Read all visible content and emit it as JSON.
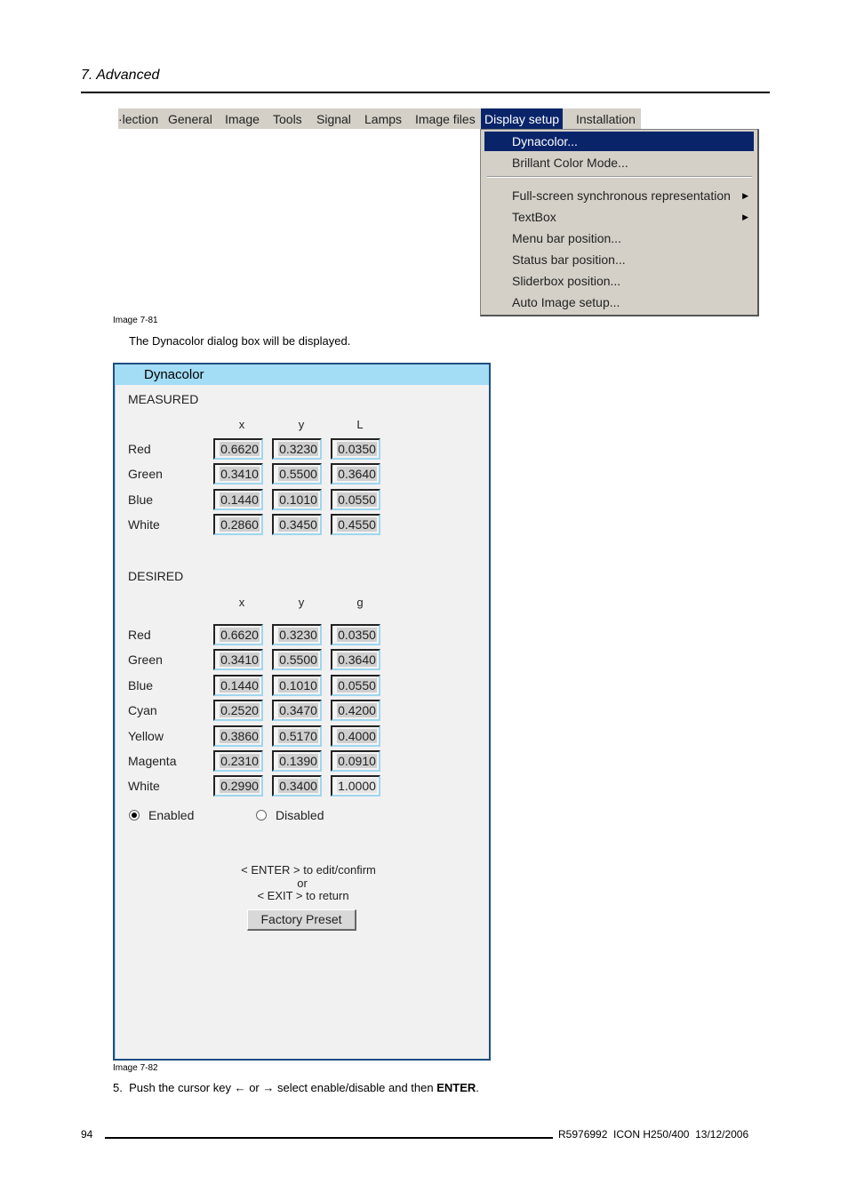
{
  "header": {
    "section": "7. Advanced"
  },
  "menubar": {
    "items": [
      "·lection",
      "General",
      "Image",
      "Tools",
      "Signal",
      "Lamps",
      "Image files",
      "Display setup",
      "Installation"
    ],
    "active": "Display setup"
  },
  "dropdown": {
    "items": [
      {
        "label": "Dynacolor..."
      },
      {
        "label": "Brillant Color Mode..."
      },
      {
        "label": "Full-screen synchronous representation",
        "arrow": "▶"
      },
      {
        "label": "TextBox",
        "arrow": "▶"
      },
      {
        "label": "Menu bar position..."
      },
      {
        "label": "Status bar position..."
      },
      {
        "label": "Sliderbox position..."
      },
      {
        "label": "Auto Image setup..."
      }
    ]
  },
  "captions": {
    "image1": "Image 7-81",
    "image2": "Image 7-82"
  },
  "intro_text": "The Dynacolor dialog box will be displayed.",
  "dialog": {
    "title": "Dynacolor",
    "measured": {
      "label": "MEASURED",
      "columns": [
        "x",
        "y",
        "L"
      ],
      "rows": [
        {
          "label": "Red",
          "values": [
            "0.6620",
            "0.3230",
            "0.0350"
          ]
        },
        {
          "label": "Green",
          "values": [
            "0.3410",
            "0.5500",
            "0.3640"
          ]
        },
        {
          "label": "Blue",
          "values": [
            "0.1440",
            "0.1010",
            "0.0550"
          ]
        },
        {
          "label": "White",
          "values": [
            "0.2860",
            "0.3450",
            "0.4550"
          ]
        }
      ]
    },
    "desired": {
      "label": "DESIRED",
      "columns": [
        "x",
        "y",
        "g"
      ],
      "rows": [
        {
          "label": "Red",
          "values": [
            "0.6620",
            "0.3230",
            "0.0350"
          ]
        },
        {
          "label": "Green",
          "values": [
            "0.3410",
            "0.5500",
            "0.3640"
          ]
        },
        {
          "label": "Blue",
          "values": [
            "0.1440",
            "0.1010",
            "0.0550"
          ]
        },
        {
          "label": "Cyan",
          "values": [
            "0.2520",
            "0.3470",
            "0.4200"
          ]
        },
        {
          "label": "Yellow",
          "values": [
            "0.3860",
            "0.5170",
            "0.4000"
          ]
        },
        {
          "label": "Magenta",
          "values": [
            "0.2310",
            "0.1390",
            "0.0910"
          ]
        },
        {
          "label": "White",
          "values": [
            "0.2990",
            "0.3400",
            "1.0000"
          ]
        }
      ]
    },
    "radio": {
      "enabled_label": "Enabled",
      "disabled_label": "Disabled",
      "selected": "Enabled"
    },
    "hint": {
      "line1": "< ENTER > to edit/confirm",
      "line2": "or",
      "line3": "< EXIT > to return"
    },
    "factory_button": "Factory Preset"
  },
  "step": {
    "number": "5.",
    "text": "Push the cursor key ← or → select enable/disable and then ",
    "bold": "ENTER",
    "end": "."
  },
  "footer": {
    "page": "94",
    "doc": "R5976992  ICON H250/400  13/12/2006"
  }
}
